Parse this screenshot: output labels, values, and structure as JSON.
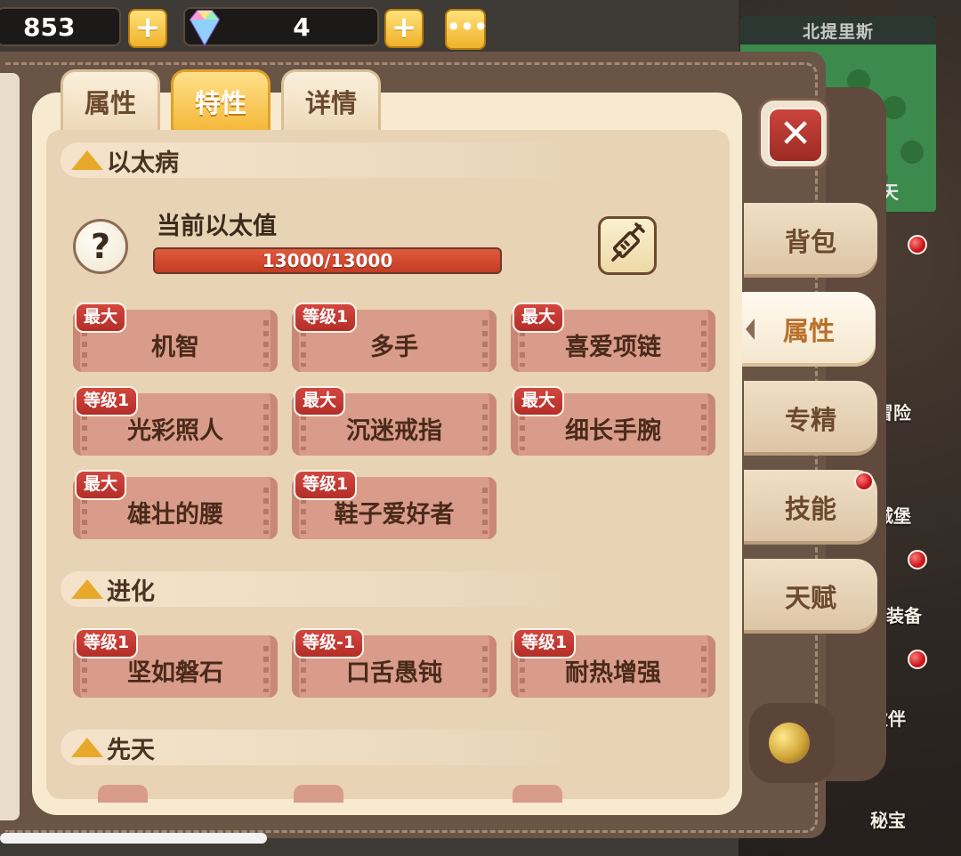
{
  "top_bar": {
    "gold_value": "853",
    "gem_value": "4",
    "more_label": "•••"
  },
  "map": {
    "title": "北提里斯",
    "bottom_text": "白天",
    "side_labels": [
      "冒险",
      "城堡",
      "装备",
      "伙伴",
      "秘宝"
    ]
  },
  "tabs": [
    {
      "label": "属性",
      "active": false
    },
    {
      "label": "特性",
      "active": true
    },
    {
      "label": "详情",
      "active": false
    }
  ],
  "side_tabs": [
    {
      "label": "背包",
      "active": false,
      "badge": false
    },
    {
      "label": "属性",
      "active": true,
      "badge": false
    },
    {
      "label": "专精",
      "active": false,
      "badge": false
    },
    {
      "label": "技能",
      "active": false,
      "badge": true
    },
    {
      "label": "天赋",
      "active": false,
      "badge": false
    }
  ],
  "sections": {
    "ether_disease": {
      "title": "以太病",
      "ether_label": "当前以太值",
      "ether_text": "13000/13000",
      "ether_fraction": 1.0,
      "traits": [
        {
          "badge": "最大",
          "name": "机智"
        },
        {
          "badge": "等级1",
          "name": "多手"
        },
        {
          "badge": "最大",
          "name": "喜爱项链"
        },
        {
          "badge": "等级1",
          "name": "光彩照人"
        },
        {
          "badge": "最大",
          "name": "沉迷戒指"
        },
        {
          "badge": "最大",
          "name": "细长手腕"
        },
        {
          "badge": "最大",
          "name": "雄壮的腰"
        },
        {
          "badge": "等级1",
          "name": "鞋子爱好者"
        }
      ]
    },
    "evolution": {
      "title": "进化",
      "traits": [
        {
          "badge": "等级1",
          "name": "坚如磐石"
        },
        {
          "badge": "等级-1",
          "name": "口舌愚钝"
        },
        {
          "badge": "等级1",
          "name": "耐热增强"
        }
      ]
    },
    "innate": {
      "title": "先天"
    }
  },
  "colors": {
    "active_tab": "#f4b93a",
    "ether_bar": "#c43c24",
    "trait_card": "#d99c8a",
    "badge": "#b32e28"
  }
}
